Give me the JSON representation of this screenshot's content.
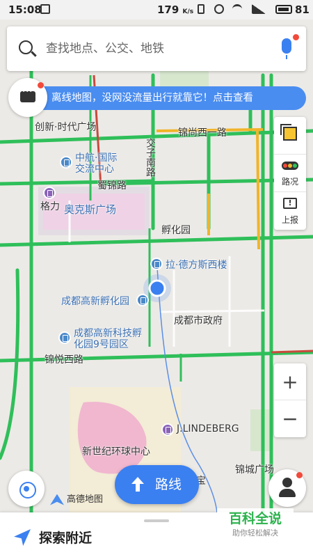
{
  "status_bar": {
    "time": "15:08",
    "speed": "179",
    "speed_unit": "K/s",
    "battery": "81"
  },
  "search": {
    "placeholder": "查找地点、公交、地铁"
  },
  "banner": {
    "text": "离线地图，没网没流量出行就靠它！点击查看"
  },
  "tools": [
    {
      "name": "layers",
      "label": ""
    },
    {
      "name": "traffic",
      "label": "路况"
    },
    {
      "name": "report",
      "label": "上报"
    }
  ],
  "zoom": {
    "in": "+",
    "out": "−"
  },
  "map_labels": {
    "chuangxin": "创新·时代广场",
    "jinshang": "锦尚西一路",
    "zhonghang": "中航·国际",
    "jiaoliu": "交流中心",
    "shujin": "蜀锦路",
    "geli": "格力",
    "aokesi": "奥克斯广场",
    "fuhuayuan": "孵化园",
    "lade": "拉·德方斯西楼",
    "gaoxinfuhua": "成都高新孵化园",
    "zhengfu": "成都市政府",
    "keji1": "成都高新科技孵",
    "keji2": "化园9号园区",
    "jinyue": "锦悦西路",
    "lindeberg": "J.LINDEBERG",
    "xinshiji": "新世纪环球中心",
    "jincheng": "锦城广场",
    "jiaozi": "交子南路",
    "baoshi": "宝"
  },
  "colors": {
    "accent": "#3b80f0",
    "road_green": "#2fbf5a",
    "road_yellow": "#f0b429",
    "road_red": "#c84a3c"
  },
  "route_button": {
    "label": "路线"
  },
  "logo": {
    "text": "高德地图"
  },
  "sheet": {
    "title": "探索附近"
  },
  "watermark": {
    "line1": "百科全说",
    "line2": "助你轻松解决"
  }
}
